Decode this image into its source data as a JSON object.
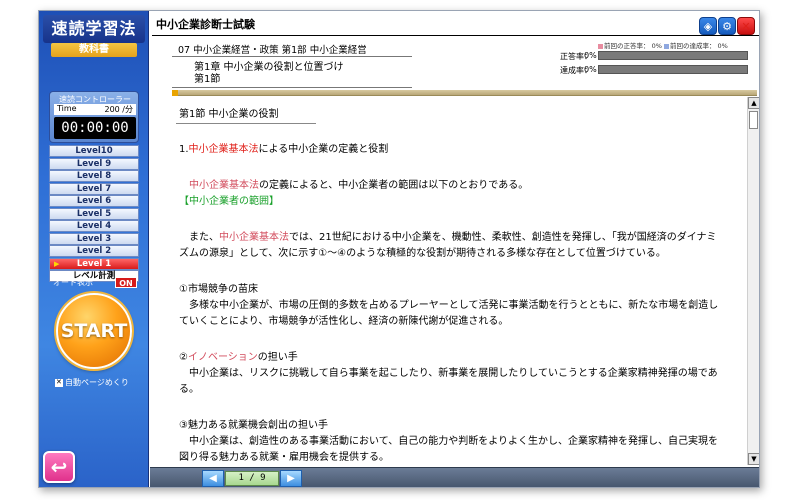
{
  "sidebar": {
    "logo_title": "速読学習法",
    "logo_sub": "教科書",
    "controller_label": "速読コントローラー",
    "time_label": "Time",
    "time_value": "200 /分",
    "timer": "00:00:00",
    "levels": [
      "Level10",
      "Level 9",
      "Level 8",
      "Level 7",
      "Level 6",
      "Level 5",
      "Level 4",
      "Level 3",
      "Level 2",
      "Level 1"
    ],
    "active_level": "Level 1",
    "measure_label": "レベル計測",
    "auto_display_label": "オート表示",
    "auto_display_state": "ON",
    "start_label": "START",
    "auto_page_label": "自動ページめくり",
    "back_icon": "↩"
  },
  "header": {
    "exam_title": "中小企業診断士試験",
    "icons": [
      "cube-icon",
      "gear-icon",
      "close-icon"
    ],
    "breadcrumb": "07 中小企業経営・政策 第1部 中小企業経営",
    "chapter_line1": "第1章 中小企業の役割と位置づけ",
    "chapter_line2": "第1節"
  },
  "stats": {
    "legend_prev_correct": "前回の正答率：",
    "legend_prev_correct_val": "0%",
    "legend_prev_reach": "前回の達成率：",
    "legend_prev_reach_val": "0%",
    "correct_label": "正答率：",
    "correct_val": "0%",
    "reach_label": "達成率：",
    "reach_val": "0%"
  },
  "content": {
    "section_head": "第1節 中小企業の役割",
    "h1_prefix": "1.",
    "h1_red": "中小企業基本法",
    "h1_rest": "による中小企業の定義と役割",
    "p1_pink": "中小企業基本法",
    "p1_rest": "の定義によると、中小企業者の範囲は以下のとおりである。",
    "p1_green": "【中小企業者の範囲】",
    "p2_a": "また、",
    "p2_pink": "中小企業基本法",
    "p2_b": "では、21世紀における中小企業を、機動性、柔軟性、創造性を発揮し、「我が国経済のダイナミ",
    "p2_c": "ズムの源泉」として、次に示す①～④のような積極的な役割が期待される多様な存在として位置づけている。",
    "i1_title": "①市場競争の苗床",
    "i1_l1": "多様な中小企業が、市場の圧倒的多数を占めるプレーヤーとして活発に事業活動を行うとともに、新たな市場を創造し",
    "i1_l2": "ていくことにより、市場競争が活性化し、経済の新陳代謝が促進される。",
    "i2_prefix": "②",
    "i2_pink": "イノベーション",
    "i2_rest": "の担い手",
    "i2_l1": "中小企業は、リスクに挑戦して自ら事業を起こしたり、新事業を展開したりしていこうとする企業家精神発揮の場であ",
    "i2_l2": "る。",
    "i3_title": "③魅力ある就業機会創出の担い手",
    "i3_l1": "中小企業は、創造性のある事業活動において、自己の能力や判断をよりよく生かし、企業家精神を発揮し、自己実現を",
    "i3_l2": "図り得る魅力ある就業・雇用機会を提供する。"
  },
  "pager": {
    "prev": "◀",
    "page": "1 / 9",
    "next": "▶"
  },
  "colors": {
    "sidebar_blue": "#2f6fd6",
    "accent_red": "#e0201a",
    "accent_pink": "#d24b5c",
    "accent_green": "#19a02a",
    "start_orange": "#ffa21a"
  }
}
